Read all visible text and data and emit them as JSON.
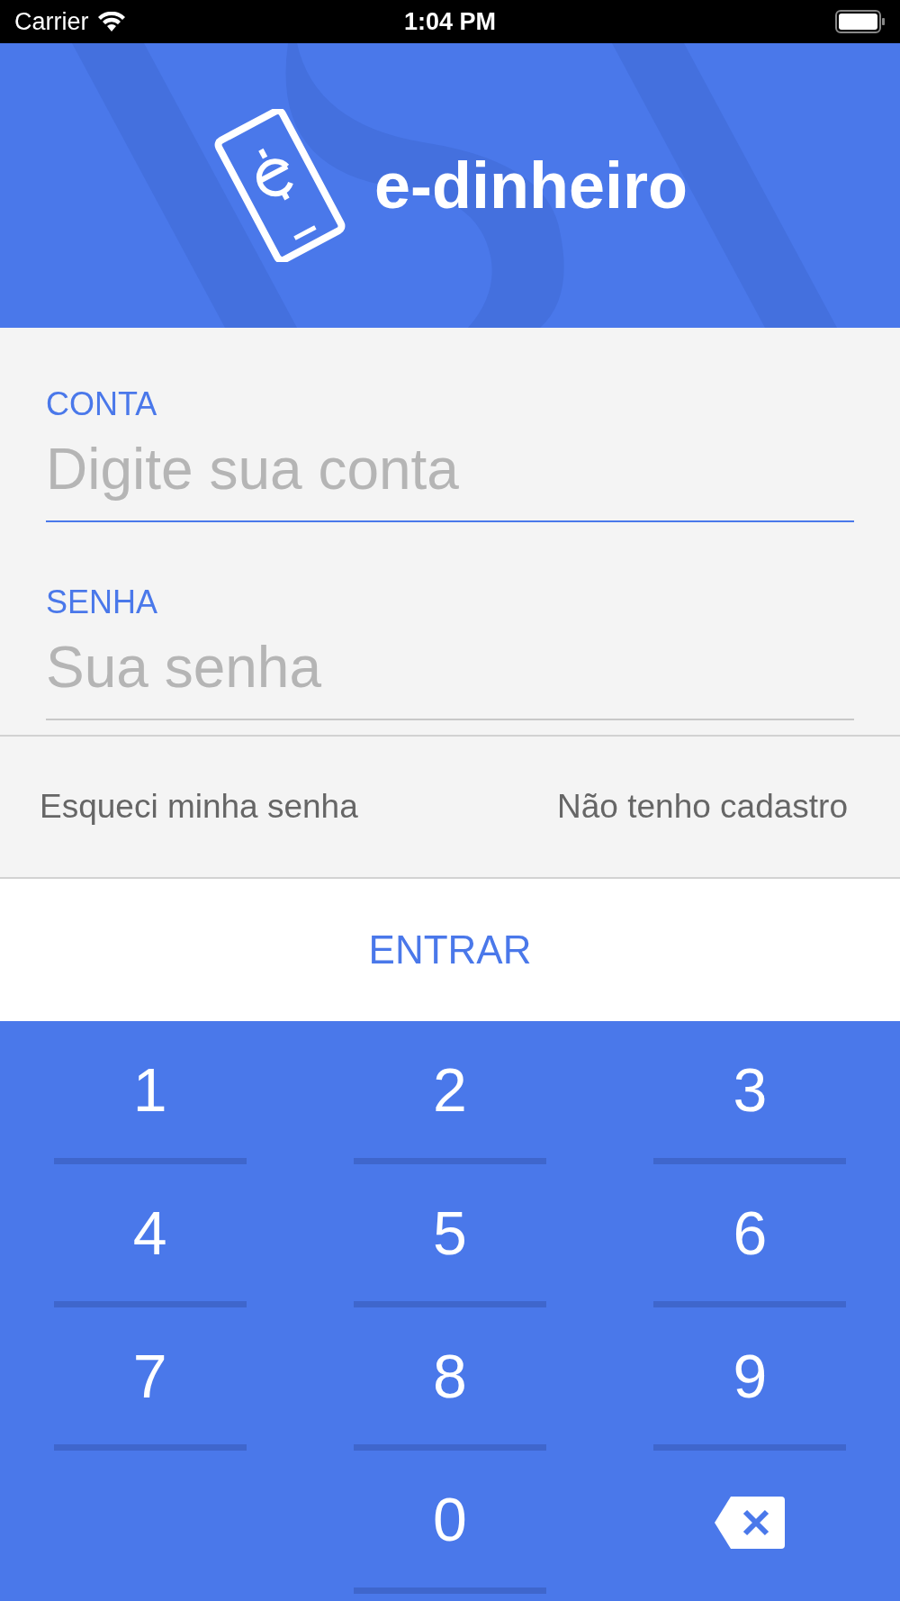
{
  "status_bar": {
    "carrier": "Carrier",
    "time": "1:04 PM"
  },
  "header": {
    "app_name": "e-dinheiro"
  },
  "fields": [
    {
      "label": "CONTA",
      "placeholder": "Digite sua conta",
      "focused": true
    },
    {
      "label": "SENHA",
      "placeholder": "Sua senha",
      "focused": false
    }
  ],
  "links": [
    "Esqueci minha senha",
    "Não tenho cadastro"
  ],
  "submit": "ENTRAR",
  "keypad": [
    {
      "kind": "digit",
      "label": "1"
    },
    {
      "kind": "digit",
      "label": "2"
    },
    {
      "kind": "digit",
      "label": "3"
    },
    {
      "kind": "digit",
      "label": "4"
    },
    {
      "kind": "digit",
      "label": "5"
    },
    {
      "kind": "digit",
      "label": "6"
    },
    {
      "kind": "digit",
      "label": "7"
    },
    {
      "kind": "digit",
      "label": "8"
    },
    {
      "kind": "digit",
      "label": "9"
    },
    {
      "kind": "blank"
    },
    {
      "kind": "digit",
      "label": "0"
    },
    {
      "kind": "backspace"
    }
  ]
}
